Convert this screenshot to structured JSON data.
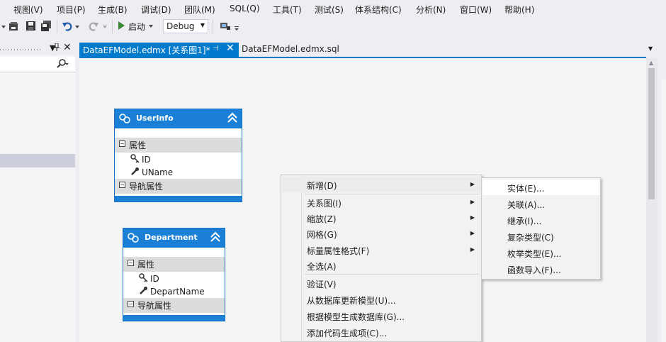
{
  "menu": [
    "视图(V)",
    "项目(P)",
    "生成(B)",
    "调试(D)",
    "团队(M)",
    "SQL(Q)",
    "工具(T)",
    "测试(S)",
    "体系结构(C)",
    "分析(N)",
    "窗口(W)",
    "帮助(H)"
  ],
  "toolbar": {
    "start_label": "启动",
    "config_value": "Debug"
  },
  "tabs": {
    "active_label": "DataEFModel.edmx [关系图1]*",
    "second_label": "DataEFModel.edmx.sql"
  },
  "entities": [
    {
      "name": "UserInfo",
      "section_props": "属性",
      "props": [
        "ID",
        "UName"
      ],
      "section_nav": "导航属性"
    },
    {
      "name": "Department",
      "section_props": "属性",
      "props": [
        "ID",
        "DepartName"
      ],
      "section_nav": "导航属性"
    }
  ],
  "context_menu": {
    "items": [
      "新增(D)",
      "关系图(I)",
      "缩放(Z)",
      "网格(G)",
      "标量属性格式(F)",
      "全选(A)",
      "验证(V)",
      "从数据库更新模型(U)...",
      "根据模型生成数据库(G)...",
      "添加代码生成项(C)..."
    ]
  },
  "submenu": {
    "items": [
      "实体(E)...",
      "关联(A)...",
      "继承(I)...",
      "复杂类型(C)",
      "枚举类型(E)...",
      "函数导入(F)..."
    ]
  },
  "colors": {
    "accent": "#007acc",
    "entity_header": "#1c7fd6"
  }
}
